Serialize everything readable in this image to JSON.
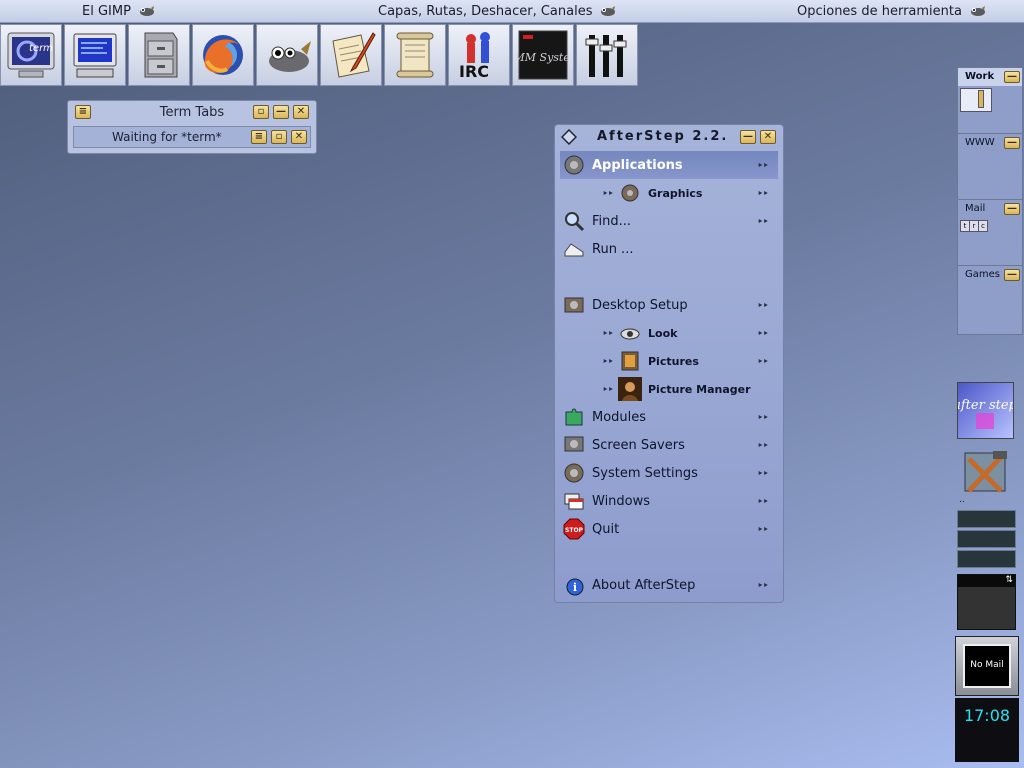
{
  "taskbar": {
    "tasks": [
      {
        "label": "El GIMP",
        "icon": "wilber-icon"
      },
      {
        "label": "Capas, Rutas, Deshacer, Canales",
        "icon": "wilber-icon"
      },
      {
        "label": "Opciones de herramienta",
        "icon": "wilber-icon"
      }
    ]
  },
  "launcher": {
    "items": [
      {
        "name": "aterm",
        "label": "term",
        "icon": "terminal-icon"
      },
      {
        "name": "monitor",
        "icon": "monitor-icon"
      },
      {
        "name": "file-manager",
        "icon": "file-cabinet-icon"
      },
      {
        "name": "firefox",
        "icon": "firefox-icon"
      },
      {
        "name": "gimp",
        "icon": "gimp-icon"
      },
      {
        "name": "text-editor",
        "icon": "quill-paper-icon"
      },
      {
        "name": "viewer",
        "icon": "scroll-icon"
      },
      {
        "name": "irc",
        "label": "IRC",
        "icon": "irc-icon"
      },
      {
        "name": "xmms",
        "label": "XMM System",
        "icon": "xmms-icon"
      },
      {
        "name": "mixer",
        "icon": "mixer-sliders-icon"
      }
    ]
  },
  "term_tabs": {
    "title": "Term Tabs",
    "tab_label": "Waiting for *term*"
  },
  "menu": {
    "title": "AfterStep 2.2.",
    "items": [
      {
        "label": "Applications",
        "icon": "gears-icon",
        "selected": true,
        "sub": false
      },
      {
        "label": "Graphics",
        "icon": "gears-icon",
        "sub": true
      },
      {
        "label": "Find...",
        "icon": "magnifier-icon",
        "sub": false
      },
      {
        "label": "Run ...",
        "icon": "sneaker-icon",
        "sub": false
      },
      {
        "label": "Desktop Setup",
        "icon": "gears-icon",
        "sub": false
      },
      {
        "label": "Look",
        "icon": "eye-icon",
        "sub": true
      },
      {
        "label": "Pictures",
        "icon": "gears-icon",
        "sub": true
      },
      {
        "label": "Picture Manager",
        "icon": "portrait-icon",
        "sub": true
      },
      {
        "label": "Modules",
        "icon": "puzzle-icon",
        "sub": false
      },
      {
        "label": "Screen Savers",
        "icon": "gears-icon",
        "sub": false
      },
      {
        "label": "System Settings",
        "icon": "gears-icon",
        "sub": false
      },
      {
        "label": "Windows",
        "icon": "windows-icon",
        "sub": false
      },
      {
        "label": "Quit",
        "icon": "stop-sign-icon",
        "sub": false,
        "stop_text": "STOP"
      },
      {
        "label": "About AfterStep",
        "icon": "info-icon",
        "sub": false
      }
    ]
  },
  "pager": {
    "desks": [
      {
        "label": "Work"
      },
      {
        "label": "WWW"
      },
      {
        "label": "Mail",
        "mini_windows": [
          "t",
          "r",
          "c"
        ]
      },
      {
        "label": "Games"
      }
    ]
  },
  "wharf": {
    "afterstep_logo_text": "after step",
    "mail_status": "No Mail",
    "clock": "17:08"
  },
  "colors": {
    "accent_gold": "#e3c26b",
    "menu_bg": "#98a7d4",
    "clock_text": "#28e0f0"
  }
}
